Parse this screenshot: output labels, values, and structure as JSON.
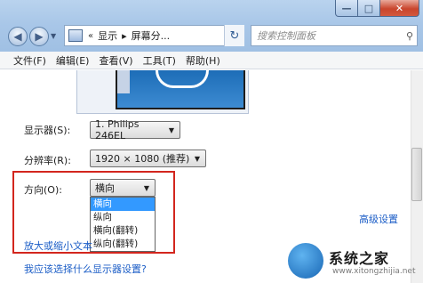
{
  "window": {
    "caption_min": "—",
    "caption_max": "□",
    "caption_close": "✕"
  },
  "nav": {
    "back": "◀",
    "forward": "▶",
    "address_prefix": "«",
    "breadcrumb": [
      "显示",
      "▸",
      "屏幕分..."
    ],
    "refresh": "↻",
    "search_placeholder": "搜索控制面板",
    "search_icon": "magnifier-icon"
  },
  "menu": {
    "items": [
      "文件(F)",
      "编辑(E)",
      "查看(V)",
      "工具(T)",
      "帮助(H)"
    ]
  },
  "form": {
    "display_label": "显示器(S):",
    "display_value": "1. Philips 246EL",
    "resolution_label": "分辨率(R):",
    "resolution_value": "1920 × 1080 (推荐)",
    "orientation_label": "方向(O):",
    "orientation_value": "横向",
    "orientation_options": [
      "横向",
      "纵向",
      "横向(翻转)",
      "纵向(翻转)"
    ]
  },
  "links": {
    "advanced": "高级设置",
    "make_text": "放大或缩小文本",
    "which_display": "我应该选择什么显示器设置?"
  },
  "watermark": {
    "name": "系统之家",
    "url": "www.xitongzhijia.net"
  },
  "colors": {
    "highlight": "#d3261e",
    "selection": "#3399ff",
    "link": "#1c5ec7"
  }
}
